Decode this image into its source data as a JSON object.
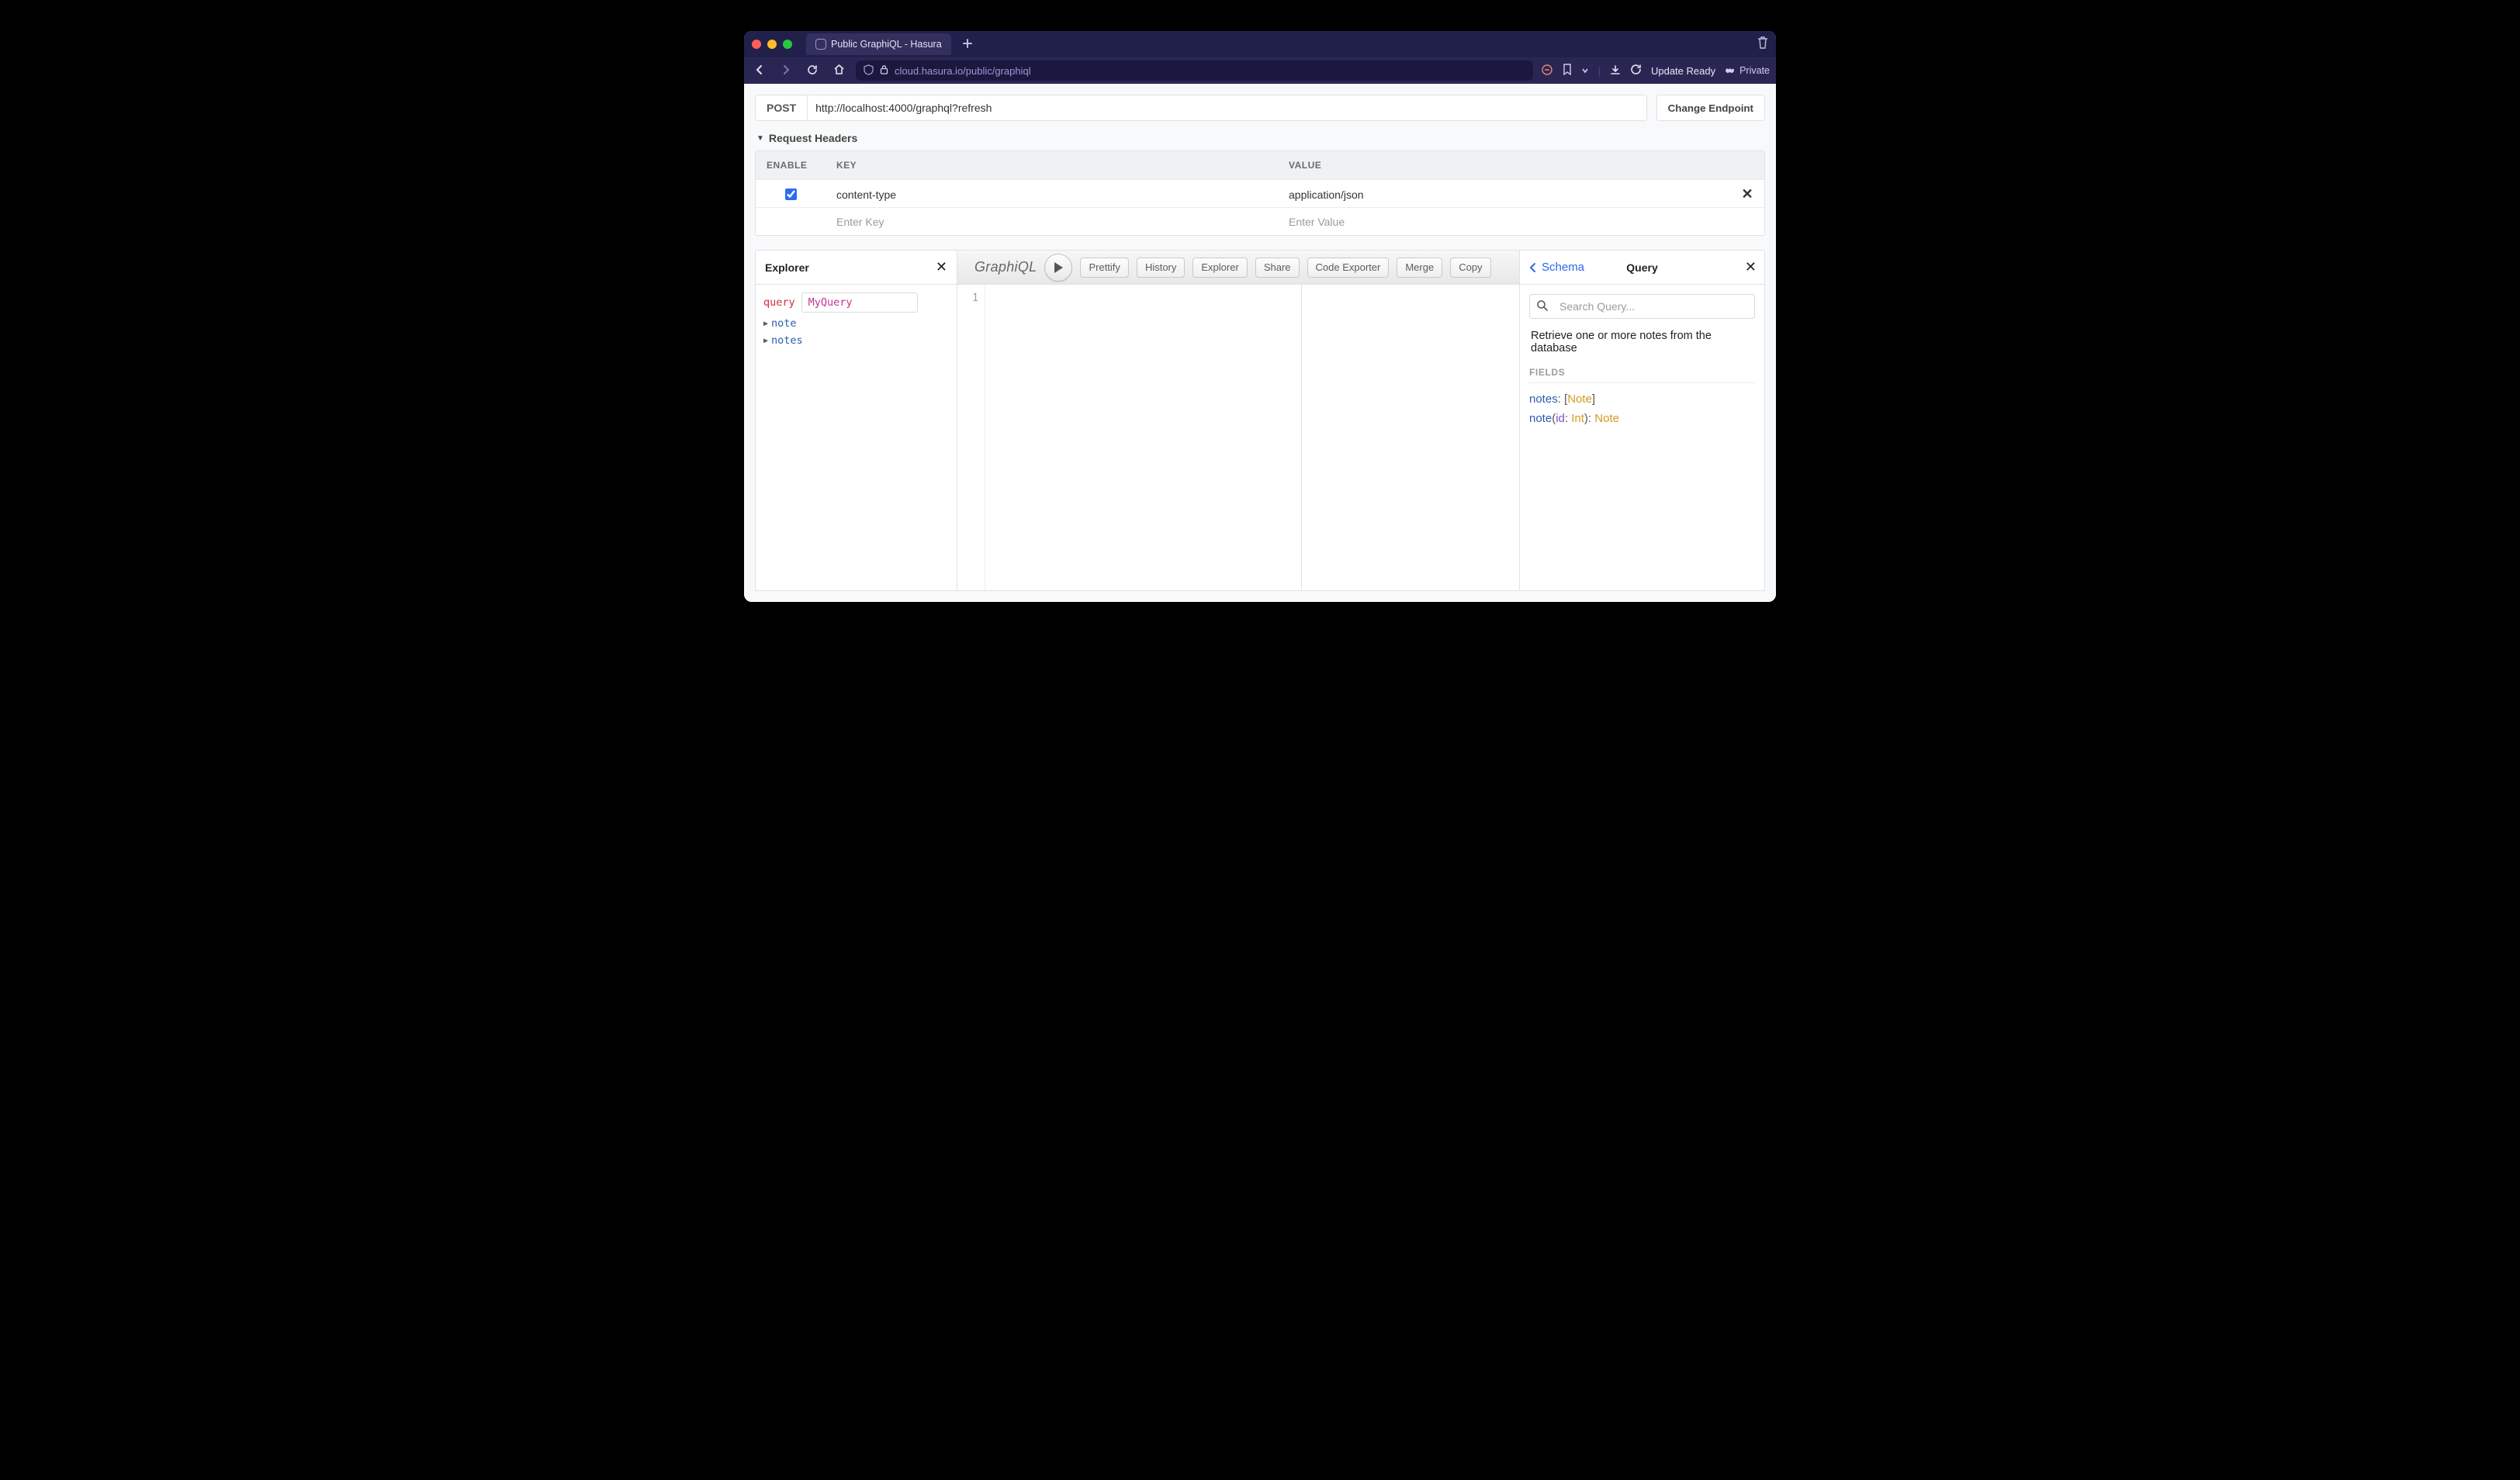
{
  "browser": {
    "tab_title": "Public GraphiQL - Hasura",
    "url": "cloud.hasura.io/public/graphiql",
    "update_label": "Update Ready",
    "private_label": "Private"
  },
  "endpoint": {
    "method": "POST",
    "url": "http://localhost:4000/graphql?refresh",
    "change_label": "Change Endpoint"
  },
  "headers_section": {
    "title": "Request Headers",
    "columns": {
      "enable": "ENABLE",
      "key": "KEY",
      "value": "VALUE"
    },
    "rows": [
      {
        "enabled": true,
        "key": "content-type",
        "value": "application/json"
      }
    ],
    "placeholders": {
      "key": "Enter Key",
      "value": "Enter Value"
    }
  },
  "explorer": {
    "title": "Explorer",
    "keyword": "query",
    "query_name": "MyQuery",
    "fields": [
      "note",
      "notes"
    ]
  },
  "graphiql": {
    "logo": "GraphiQL",
    "toolbar": [
      "Prettify",
      "History",
      "Explorer",
      "Share",
      "Code Exporter",
      "Merge",
      "Copy"
    ],
    "line_number": "1"
  },
  "docs": {
    "schema_link": "Schema",
    "title": "Query",
    "search_placeholder": "Search Query...",
    "description": "Retrieve one or more notes from the database",
    "fields_label": "FIELDS",
    "fields": [
      {
        "name": "notes",
        "return_open": "[",
        "return_type": "Note",
        "return_close": "]",
        "args": []
      },
      {
        "name": "note",
        "return_open": "",
        "return_type": "Note",
        "return_close": "",
        "args": [
          {
            "name": "id",
            "type": "Int"
          }
        ]
      }
    ]
  }
}
